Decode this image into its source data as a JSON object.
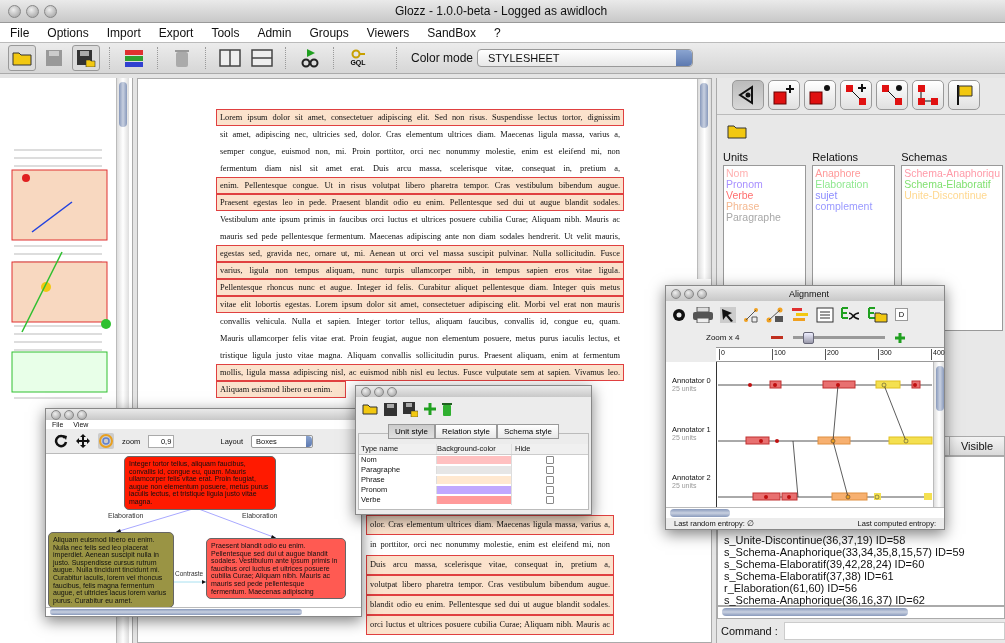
{
  "window": {
    "title": "Glozz - 1.0.0-beta - Logged as awidloch"
  },
  "menu": [
    "File",
    "Options",
    "Import",
    "Export",
    "Tools",
    "Admin",
    "Groups",
    "Viewers",
    "SandBox",
    "?"
  ],
  "toolbar": {
    "gql_label": "GQL",
    "color_mode_label": "Color mode",
    "color_mode": "STYLESHEET"
  },
  "document": {
    "lines": [
      {
        "text": "Lorem ipsum dolor sit amet, consectetuer adipiscing elit. Sed non risus. Suspendisse lectus tortor, dignissim",
        "highlighted": true
      },
      {
        "text": "sit amet, adipiscing nec, ultricies sed, dolor. Cras elementum ultrices diam. Maecenas ligula massa, varius a,",
        "highlighted": false
      },
      {
        "text": "semper congue, euismod non, mi. Proin porttitor, orci nec nonummy molestie, enim est eleifend mi, non",
        "highlighted": false
      },
      {
        "text": "fermentum diam nisl sit amet erat. Duis arcu massa, scelerisque vitae, consequat in, pretium a,",
        "highlighted": false
      },
      {
        "text": "enim. Pellentesque congue. Ut in risus volutpat libero pharetra tempor. Cras vestibulum bibendum augue.",
        "highlighted": true
      },
      {
        "text": "Praesent egestas leo in pede. Praesent blandit odio eu enim. Pellentesque sed dui ut augue blandit sodales.",
        "highlighted": true
      },
      {
        "text": "Vestibulum ante ipsum primis in faucibus orci luctus et ultrices posuere cubilia Curae; Aliquam nibh. Mauris ac",
        "highlighted": false
      },
      {
        "text": "mauris sed pede pellentesque fermentum. Maecenas adipiscing ante non diam sodales hendrerit. Ut velit mauris,",
        "highlighted": false
      },
      {
        "text": "egestas sed, gravida nec, ornare ut, mi. Aenean ut orci vel massa suscipit pulvinar. Nulla sollicitudin. Fusce",
        "highlighted": true
      },
      {
        "text": "varius, ligula non tempus aliquam, nunc turpis ullamcorper nibh, in tempus sapien eros vitae ligula.",
        "highlighted": true
      },
      {
        "text": "Pellentesque rhoncus nunc et augue. Integer id felis. Curabitur aliquet pellentesque diam. Integer quis metus",
        "highlighted": true
      },
      {
        "text": "vitae elit lobortis egestas. Lorem ipsum dolor sit amet, consectetuer adipiscing elit. Morbi vel erat non mauris",
        "highlighted": true
      },
      {
        "text": "convallis vehicula. Nulla et sapien. Integer tortor tellus, aliquam faucibus, convallis id, congue eu, quam.",
        "highlighted": false
      },
      {
        "text": "Mauris ullamcorper felis vitae erat. Proin feugiat, augue non elementum posuere, metus purus iaculis lectus, et",
        "highlighted": false
      },
      {
        "text": "tristique ligula justo vitae magna. Aliquam convallis sollicitudin purus. Praesent aliquam, enim at fermentum",
        "highlighted": false
      },
      {
        "text": "mollis, ligula massa adipiscing nisl, ac euismod nibh nisl eu lectus. Fusce vulputate sem at sapien. Vivamus leo.",
        "highlighted": true
      },
      {
        "text": "Aliquam euismod libero eu enim.",
        "highlighted": true
      }
    ],
    "lower_lines": [
      {
        "text": "olor. Cras elementum ultrices diam. Maecenas ligula massa, varius a,",
        "highlighted": true
      },
      {
        "text": "in porttitor, orci nec nonummy molestie, enim est eleifend mi, non",
        "highlighted": false
      },
      {
        "text": "Duis arcu massa, scelerisque vitae, consequat in, pretium a,",
        "highlighted": true
      },
      {
        "text": "volutpat libero pharetra tempor. Cras vestibulum bibendum augue.",
        "highlighted": true
      },
      {
        "text": "blandit odio eu enim. Pellentesque sed dui ut augue blandit sodales.",
        "highlighted": true
      },
      {
        "text": "orci luctus et ultrices posuere cubilia Curae; Aliquam nibh. Mauris ac",
        "highlighted": true
      }
    ]
  },
  "right_panel": {
    "tools": [
      {
        "selected": true
      },
      {
        "selected": false
      },
      {
        "selected": false
      },
      {
        "selected": false
      },
      {
        "selected": false
      },
      {
        "selected": false
      },
      {
        "selected": false
      }
    ],
    "lists": [
      {
        "title": "Units",
        "items": [
          {
            "label": "Nom",
            "color": "#ffb0b0"
          },
          {
            "label": "Pronom",
            "color": "#a890ff"
          },
          {
            "label": "Verbe",
            "color": "#ff7070"
          },
          {
            "label": "Phrase",
            "color": "#f4b890"
          },
          {
            "label": "Paragraphe",
            "color": "#a8a8a8"
          }
        ]
      },
      {
        "title": "Relations",
        "items": [
          {
            "label": "Anaphore",
            "color": "#ff9a9a"
          },
          {
            "label": "Elaboration",
            "color": "#90e890"
          },
          {
            "label": "sujet",
            "color": "#8c8cff"
          },
          {
            "label": "complement",
            "color": "#9a9aff"
          }
        ]
      },
      {
        "title": "Schemas",
        "items": [
          {
            "label": "Schema-Anaphoriqu",
            "color": "#ff9aa8"
          },
          {
            "label": "Schema-Elaboratif",
            "color": "#80e070"
          },
          {
            "label": "Unite-Discontinue",
            "color": "#ffd890"
          }
        ]
      }
    ],
    "visible_header": "Visible",
    "entries": [
      "s_Unite-Discontinue(36,37,19) ID=58",
      "s_Schema-Anaphorique(33,34,35,8,15,57) ID=59",
      "s_Schema-Elaboratif(39,42,28,24) ID=60",
      "s_Schema-Elaboratif(37,38) ID=61",
      "r_Elaboration(61,60) ID=56",
      "s_Schema-Anaphorique(36,16,37) ID=62"
    ],
    "command_label": "Command :"
  },
  "alignment": {
    "title": "Alignment",
    "action_label": "D",
    "zoom_label": "Zoom x 4",
    "zoom": {
      "level": 0.15
    },
    "ticks": [
      "0",
      "100",
      "200",
      "300",
      "400"
    ],
    "annotators": [
      {
        "name": "Annotator 0",
        "units": "25 units"
      },
      {
        "name": "Annotator 1",
        "units": "25 units"
      },
      {
        "name": "Annotator 2",
        "units": "25 units"
      }
    ],
    "random_entropy": "Last random entropy: ∅",
    "computed_entropy": "Last computed entropy:"
  },
  "graph_window": {
    "menu": [
      "File",
      "View"
    ],
    "zoom_label": "zoom",
    "zoom_value": "0,9",
    "layout_label": "Layout",
    "layout": "Boxes",
    "nodes": [
      {
        "text": "Integer tortor tellus, aliquam faucibus, convallis id, congue eu, quam. Mauris ullamcorper felis vitae erat. Proin feugiat, augue non elementum posuere, metus purus iaculis lectus, et tristique ligula justo vitae magna.",
        "color": "#ff1a00"
      },
      {
        "text": "Aliquam euismod libero eu enim. Nulla nec felis sed leo placerat imperdiet. Aenean suscipit nulla in justo. Suspendisse cursus rutrum augue. Nulla tincidunt tincidunt mi. Curabitur iaculis, lorem vel rhoncus faucibus, felis magna fermentum augue, et ultricies lacus lorem varius purus. Curabitur eu amet.",
        "color": "#9a9444"
      },
      {
        "text": "Praesent blandit odio eu enim. Pellentesque sed dui ut augue blandit sodales. Vestibulum ante ipsum primis in faucibus orci luctus et ultrices posuere cubilia Curae; Aliquam nibh. Mauris ac mauris sed pede pellentesque fermentum. Maecenas adipiscing",
        "color": "#ff5a52"
      }
    ],
    "edges": [
      {
        "label": "Elaboration"
      },
      {
        "label": "Elaboration"
      },
      {
        "label": "Contraste"
      }
    ]
  },
  "style_window": {
    "tabs": [
      {
        "label": "Unit style",
        "selected": true
      },
      {
        "label": "Relation style",
        "selected": false
      },
      {
        "label": "Schema style",
        "selected": false
      }
    ],
    "columns": [
      "Type name",
      "Background-color",
      "Hide"
    ],
    "rows": [
      {
        "name": "Nom",
        "color": "#ffc0c0",
        "hide": false
      },
      {
        "name": "Paragraphe",
        "color": "#e6e6e6",
        "hide": false
      },
      {
        "name": "Phrase",
        "color": "#ffe8d0",
        "hide": false
      },
      {
        "name": "Pronom",
        "color": "#c0a8ff",
        "hide": false
      },
      {
        "name": "Verbe",
        "color": "#ff9a9a",
        "hide": false
      }
    ]
  }
}
